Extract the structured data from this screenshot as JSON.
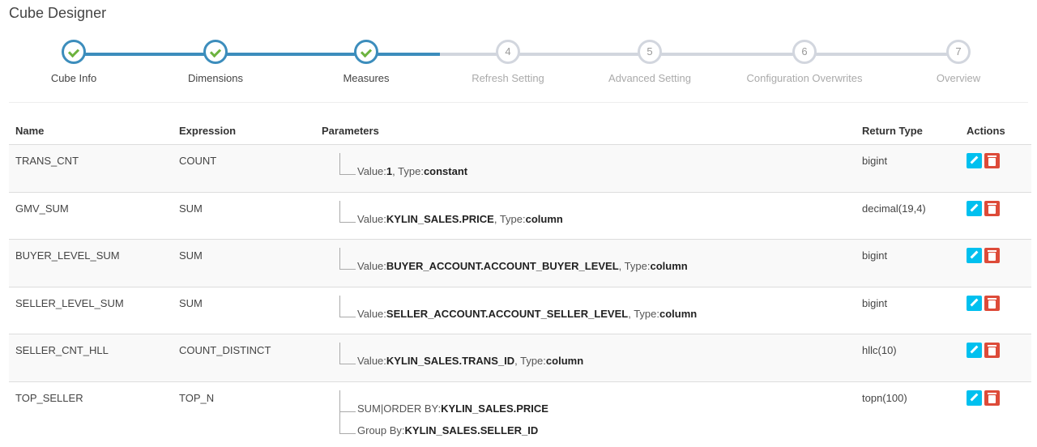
{
  "page": {
    "title": "Cube Designer"
  },
  "wizard": {
    "steps": [
      {
        "label": "Cube Info",
        "state": "done"
      },
      {
        "label": "Dimensions",
        "state": "done"
      },
      {
        "label": "Measures",
        "state": "done"
      },
      {
        "label": "Refresh Setting",
        "state": "todo",
        "number": "4"
      },
      {
        "label": "Advanced Setting",
        "state": "todo",
        "number": "5"
      },
      {
        "label": "Configuration Overwrites",
        "state": "todo",
        "number": "6"
      },
      {
        "label": "Overview",
        "state": "todo",
        "number": "7"
      }
    ]
  },
  "table": {
    "headers": {
      "name": "Name",
      "expression": "Expression",
      "parameters": "Parameters",
      "return_type": "Return Type",
      "actions": "Actions"
    },
    "rows": [
      {
        "name": "TRANS_CNT",
        "expression": "COUNT",
        "return_type": "bigint",
        "params": [
          {
            "prefix": "Value:",
            "value": "1",
            "mid": ", Type:",
            "type": "constant"
          }
        ]
      },
      {
        "name": "GMV_SUM",
        "expression": "SUM",
        "return_type": "decimal(19,4)",
        "params": [
          {
            "prefix": "Value:",
            "value": "KYLIN_SALES.PRICE",
            "mid": ", Type:",
            "type": "column"
          }
        ]
      },
      {
        "name": "BUYER_LEVEL_SUM",
        "expression": "SUM",
        "return_type": "bigint",
        "params": [
          {
            "prefix": "Value:",
            "value": "BUYER_ACCOUNT.ACCOUNT_BUYER_LEVEL",
            "mid": ", Type:",
            "type": "column"
          }
        ]
      },
      {
        "name": "SELLER_LEVEL_SUM",
        "expression": "SUM",
        "return_type": "bigint",
        "params": [
          {
            "prefix": "Value:",
            "value": "SELLER_ACCOUNT.ACCOUNT_SELLER_LEVEL",
            "mid": ", Type:",
            "type": "column"
          }
        ]
      },
      {
        "name": "SELLER_CNT_HLL",
        "expression": "COUNT_DISTINCT",
        "return_type": "hllc(10)",
        "params": [
          {
            "prefix": "Value:",
            "value": "KYLIN_SALES.TRANS_ID",
            "mid": ", Type:",
            "type": "column"
          }
        ]
      },
      {
        "name": "TOP_SELLER",
        "expression": "TOP_N",
        "return_type": "topn(100)",
        "params": [
          {
            "prefix": "SUM|ORDER BY:",
            "value": "KYLIN_SALES.PRICE",
            "mid": "",
            "type": ""
          },
          {
            "prefix": "Group By:",
            "value": "KYLIN_SALES.SELLER_ID",
            "mid": "",
            "type": ""
          }
        ]
      }
    ]
  },
  "icons": {
    "edit": "pencil-icon",
    "delete": "trash-icon"
  },
  "colors": {
    "accent": "#3c8dbc",
    "check": "#6db33f",
    "edit": "#00c0ef",
    "delete": "#dd4b39",
    "inactive": "#d2d6de"
  }
}
